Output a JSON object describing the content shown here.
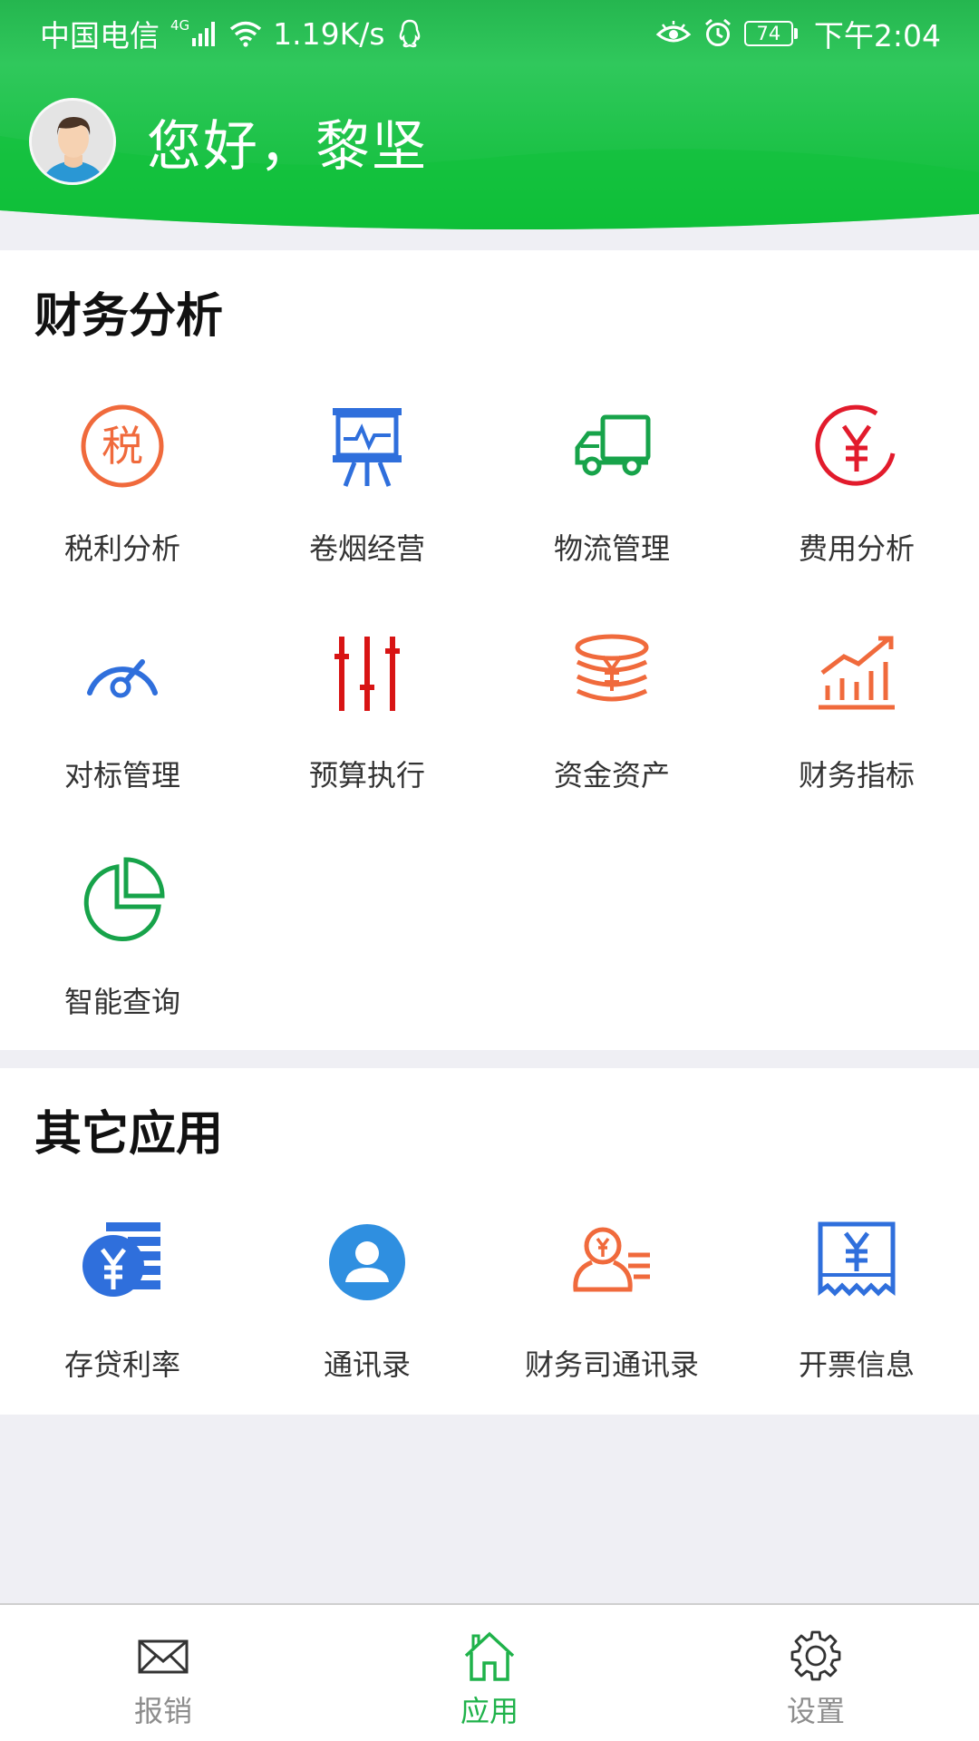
{
  "status_bar": {
    "carrier": "中国电信",
    "network": "4G",
    "speed": "1.19K/s",
    "battery": "74",
    "time": "下午2:04"
  },
  "header": {
    "greeting": "您好，黎坚",
    "colors": {
      "green_top": "#2fcb5d",
      "green_bottom": "#0fbf3a"
    }
  },
  "finance_section": {
    "title": "财务分析",
    "items": [
      {
        "label": "税利分析",
        "icon": "tax-icon",
        "color": "#f06a3c"
      },
      {
        "label": "卷烟经营",
        "icon": "presentation-board-icon",
        "color": "#2f6fdc"
      },
      {
        "label": "物流管理",
        "icon": "truck-icon",
        "color": "#17a34a"
      },
      {
        "label": "费用分析",
        "icon": "yen-circle-icon",
        "color": "#e21b2c"
      },
      {
        "label": "对标管理",
        "icon": "gauge-icon",
        "color": "#2f6fdc"
      },
      {
        "label": "预算执行",
        "icon": "sliders-icon",
        "color": "#d81414"
      },
      {
        "label": "资金资产",
        "icon": "coin-stack-icon",
        "color": "#f06a3c"
      },
      {
        "label": "财务指标",
        "icon": "bar-trend-icon",
        "color": "#f06a3c"
      },
      {
        "label": "智能查询",
        "icon": "pie-chart-icon",
        "color": "#17a34a"
      }
    ]
  },
  "other_section": {
    "title": "其它应用",
    "items": [
      {
        "label": "存贷利率",
        "icon": "yen-coin-list-icon",
        "color": "#2f6fdc"
      },
      {
        "label": "通讯录",
        "icon": "contact-icon",
        "color": "#2f8fe0"
      },
      {
        "label": "财务司通讯录",
        "icon": "finance-contact-icon",
        "color": "#f06a3c"
      },
      {
        "label": "开票信息",
        "icon": "invoice-icon",
        "color": "#2f6fdc"
      }
    ]
  },
  "bottom_nav": {
    "items": [
      {
        "label": "报销",
        "icon": "envelope-icon",
        "active": false
      },
      {
        "label": "应用",
        "icon": "home-icon",
        "active": true
      },
      {
        "label": "设置",
        "icon": "gear-icon",
        "active": false
      }
    ],
    "active_color": "#1fb24a",
    "inactive_color": "#8d8d8d"
  }
}
